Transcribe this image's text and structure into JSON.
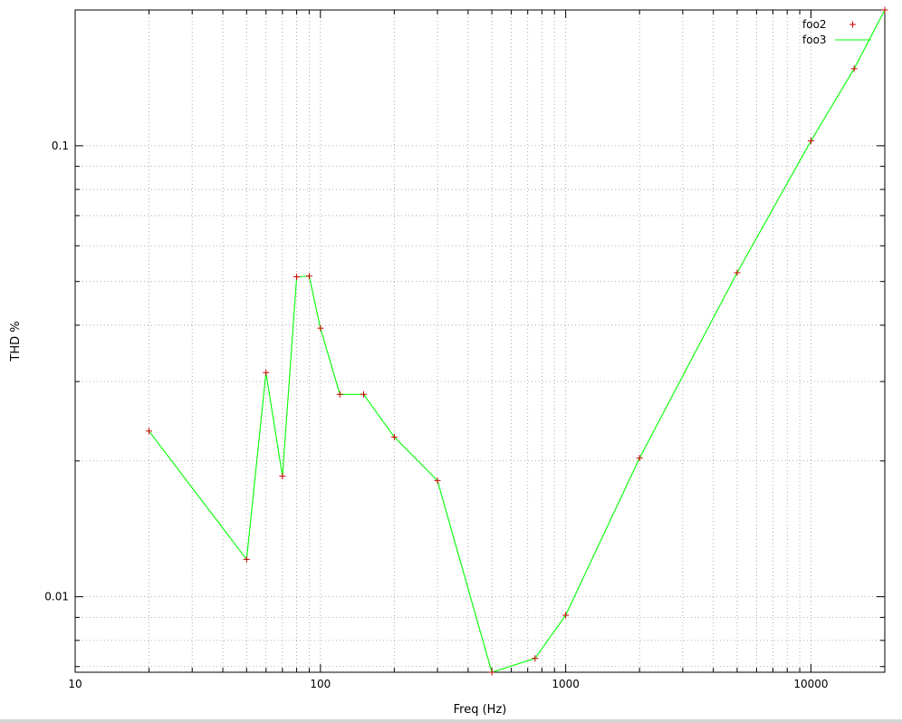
{
  "chart_data": {
    "type": "line",
    "title": "",
    "xlabel": "Freq (Hz)",
    "ylabel": "THD %",
    "x_scale": "log",
    "y_scale": "log",
    "xlim": [
      10,
      20000
    ],
    "ylim": [
      0.0068,
      0.2
    ],
    "grid": true,
    "legend_position": "top-right",
    "x_ticks": [
      {
        "value": 10,
        "label": "10"
      },
      {
        "value": 100,
        "label": "100"
      },
      {
        "value": 1000,
        "label": "1000"
      },
      {
        "value": 10000,
        "label": "10000"
      }
    ],
    "y_ticks": [
      {
        "value": 0.01,
        "label": "0.01"
      },
      {
        "value": 0.1,
        "label": "0.1"
      }
    ],
    "series": [
      {
        "name": "foo2",
        "style": "points",
        "marker": "+",
        "color": "#cc0000",
        "x": [
          20,
          50,
          60,
          70,
          80,
          90,
          100,
          120,
          150,
          200,
          300,
          500,
          750,
          1000,
          2000,
          5000,
          10000,
          15000,
          20000
        ],
        "y": [
          0.0233,
          0.0121,
          0.0314,
          0.0185,
          0.0512,
          0.0514,
          0.0394,
          0.0281,
          0.0281,
          0.0226,
          0.0181,
          0.0068,
          0.0073,
          0.0091,
          0.0203,
          0.0523,
          0.1025,
          0.1482,
          0.2
        ]
      },
      {
        "name": "foo3",
        "style": "line",
        "color": "#00ff00",
        "x": [
          20,
          50,
          60,
          70,
          80,
          90,
          100,
          120,
          150,
          200,
          300,
          500,
          750,
          1000,
          2000,
          5000,
          10000,
          15000,
          20000
        ],
        "y": [
          0.0233,
          0.0121,
          0.0314,
          0.0185,
          0.0512,
          0.0514,
          0.0394,
          0.0281,
          0.0281,
          0.0226,
          0.0181,
          0.0068,
          0.0073,
          0.0091,
          0.0203,
          0.0523,
          0.1025,
          0.1482,
          0.2
        ]
      }
    ]
  }
}
